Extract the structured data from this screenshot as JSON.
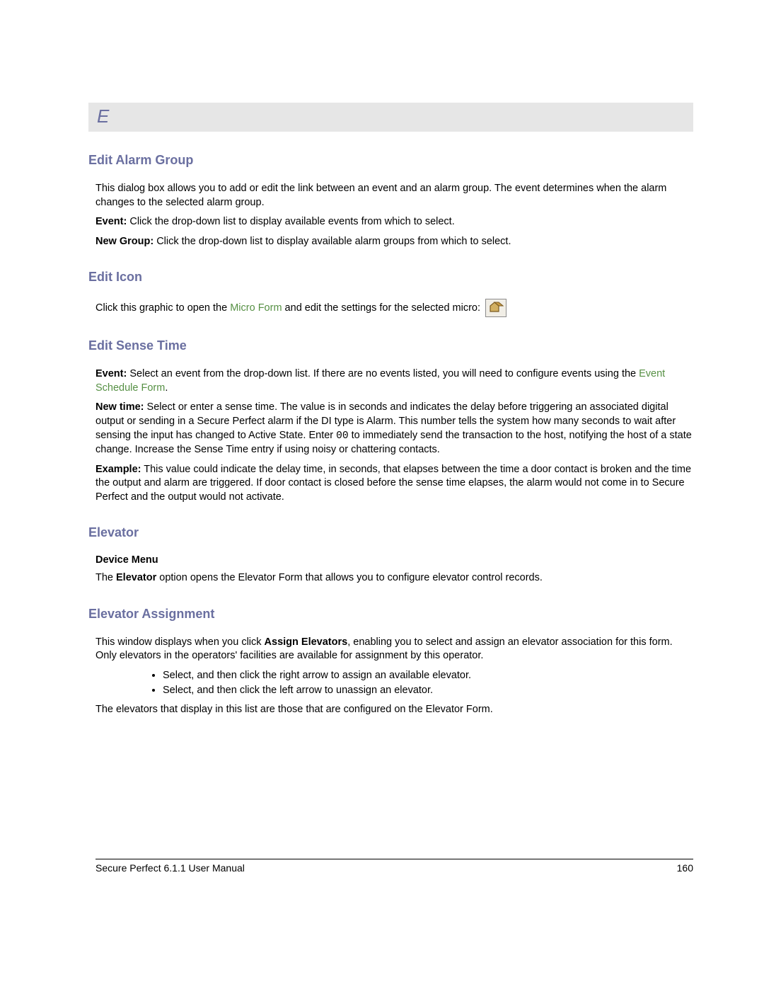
{
  "letter": "E",
  "sections": {
    "editAlarmGroup": {
      "title": "Edit Alarm Group",
      "intro": "This dialog box allows you to add or edit the link between an event and an alarm group. The event determines when the alarm changes to the selected alarm group.",
      "eventLabel": "Event:",
      "eventText": " Click the drop-down list to display available events from which to select.",
      "newGroupLabel": "New Group:",
      "newGroupText": " Click the drop-down list to display available alarm groups from which to select."
    },
    "editIcon": {
      "title": "Edit Icon",
      "pre": "Click this graphic to open the ",
      "link": "Micro Form",
      "post": " and edit the settings for the selected micro: "
    },
    "editSenseTime": {
      "title": "Edit Sense Time",
      "eventLabel": "Event:",
      "eventPre": " Select an event from the drop-down list. If there are no events listed, you will need to configure events using the ",
      "eventLink": "Event Schedule Form",
      "eventPost": ".",
      "newTimeLabel": "New time:",
      "newTimePre": " Select or enter a sense time. The value is in seconds and indicates the delay before triggering an associated digital output or sending in a Secure Perfect alarm if the DI type is Alarm. This number tells the system how many seconds to wait after sensing the input has changed to Active State. Enter ",
      "zero": "00",
      "newTimePost": " to immediately send the transaction to the host, notifying the host of a state change. Increase the Sense Time entry if using noisy or chattering contacts.",
      "exampleLabel": "Example:",
      "exampleText": " This value could indicate the delay time, in seconds, that elapses between the time a door contact is broken and the time the output and alarm are triggered. If door contact is closed before the sense time elapses, the alarm would not come in to Secure Perfect and the output would not activate."
    },
    "elevator": {
      "title": "Elevator",
      "subhead": "Device Menu",
      "textPre": "The ",
      "textBold": "Elevator",
      "textPost": " option opens the Elevator Form that allows you to configure elevator control records."
    },
    "elevatorAssignment": {
      "title": "Elevator Assignment",
      "introPre": "This window displays when you click ",
      "introBold": "Assign Elevators",
      "introPost": ", enabling you to select and assign an elevator association for this form. Only elevators in the operators' facilities are available for assignment by this operator.",
      "bullet1": "Select, and then click the right arrow to assign an available elevator.",
      "bullet2": "Select, and then click the left arrow to unassign an elevator.",
      "outro": "The elevators that display in this list are those that are configured on the Elevator Form."
    }
  },
  "footer": {
    "left": "Secure Perfect 6.1.1 User Manual",
    "right": "160"
  }
}
